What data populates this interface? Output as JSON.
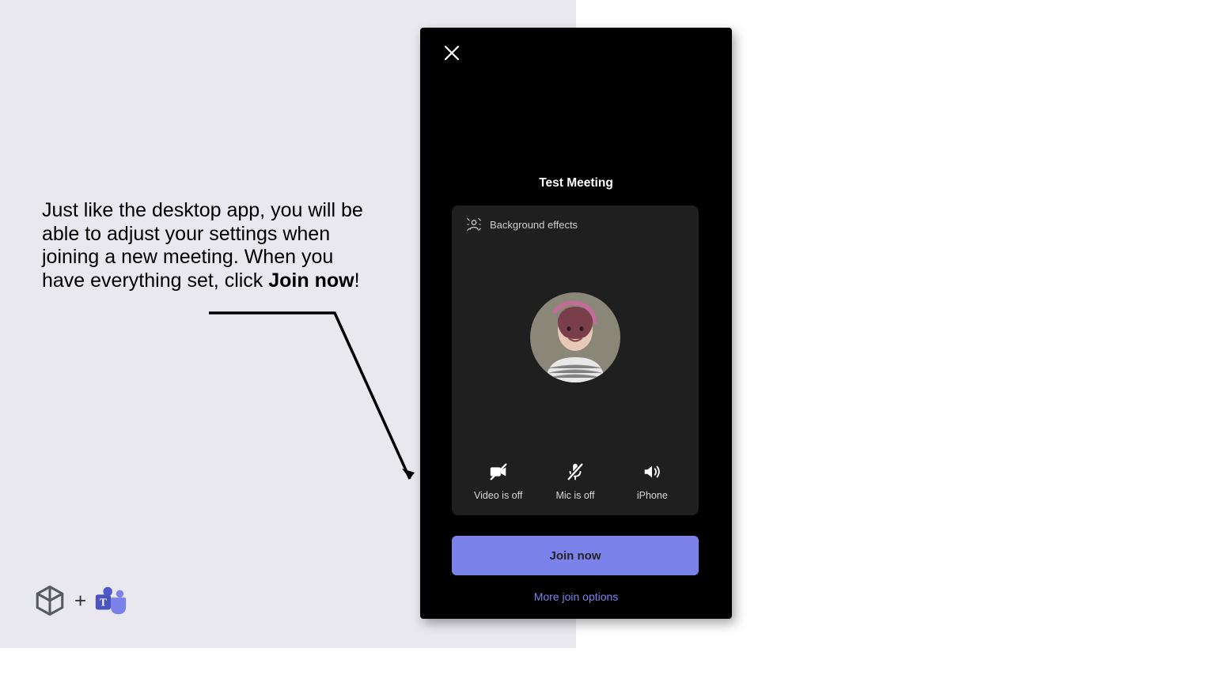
{
  "instruction": {
    "line1": "Just like the desktop app, you will be able to adjust your settings when joining a new meeting. When you have everything set, click ",
    "bold": "Join now",
    "tail": "!"
  },
  "logos": {
    "plus": "+"
  },
  "phone": {
    "meeting_title": "Test Meeting",
    "bg_effects_label": "Background effects",
    "controls": {
      "video": "Video is off",
      "mic": "Mic is off",
      "speaker": "iPhone"
    },
    "join_label": "Join now",
    "more_options_label": "More join options"
  }
}
